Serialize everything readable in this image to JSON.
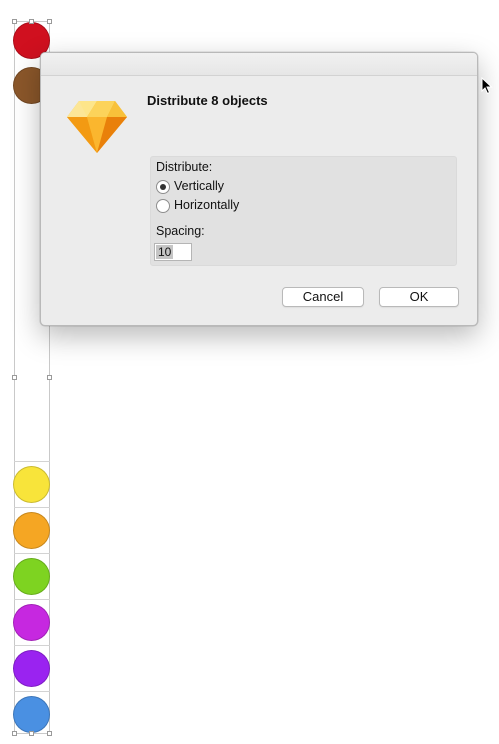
{
  "canvas": {
    "circles": [
      {
        "name": "red-circle",
        "color": "#d0101f"
      },
      {
        "name": "brown-circle",
        "color": "#8b572a"
      },
      {
        "name": "yellow-circle",
        "color": "#f8e43a"
      },
      {
        "name": "orange-circle",
        "color": "#f5a623"
      },
      {
        "name": "green-circle",
        "color": "#7ed321"
      },
      {
        "name": "magenta-circle",
        "color": "#c628e0"
      },
      {
        "name": "purple-circle",
        "color": "#9a23f0"
      },
      {
        "name": "blue-circle",
        "color": "#4a90e2"
      }
    ]
  },
  "dialog": {
    "app_icon": "sketch-diamond-icon",
    "title": "Distribute 8 objects",
    "distribute_label": "Distribute:",
    "options": [
      {
        "label": "Vertically",
        "selected": true
      },
      {
        "label": "Horizontally",
        "selected": false
      }
    ],
    "spacing_label": "Spacing:",
    "spacing_value": "10",
    "cancel_label": "Cancel",
    "ok_label": "OK"
  },
  "cursor_icon": "arrow-cursor-icon"
}
